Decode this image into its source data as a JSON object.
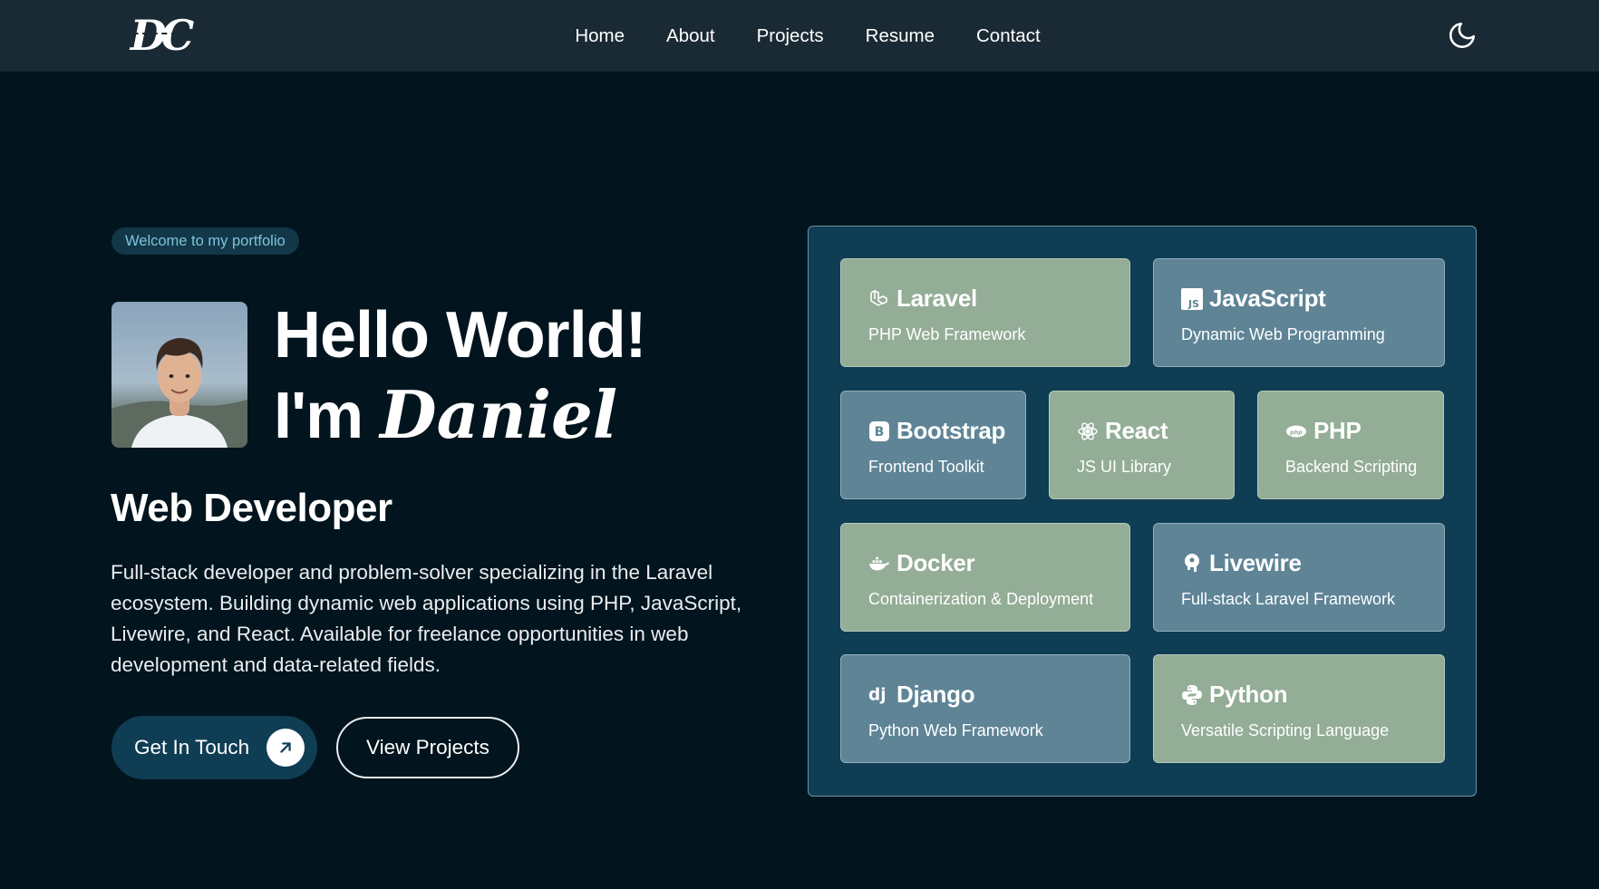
{
  "header": {
    "logo_text": "DC",
    "nav": [
      {
        "label": "Home"
      },
      {
        "label": "About"
      },
      {
        "label": "Projects"
      },
      {
        "label": "Resume"
      },
      {
        "label": "Contact"
      }
    ],
    "theme_icon": "moon-icon"
  },
  "hero": {
    "welcome": "Welcome to my portfolio",
    "greeting_line1": "Hello World!",
    "greeting_prefix": "I'm",
    "name": "Daniel",
    "role": "Web Developer",
    "bio": "Full-stack developer and problem-solver specializing in the Laravel ecosystem. Building dynamic web applications using PHP, JavaScript, Livewire, and React. Available for freelance opportunities in web development and data-related fields.",
    "primary_button": "Get In Touch",
    "primary_button_icon": "arrow-up-right-icon",
    "secondary_button": "View Projects"
  },
  "tech": {
    "cards": [
      {
        "title": "Laravel",
        "subtitle": "PHP Web Framework",
        "icon": "laravel-icon",
        "color": "#93ad96"
      },
      {
        "title": "JavaScript",
        "subtitle": "Dynamic Web Programming",
        "icon": "javascript-icon",
        "color": "#5e8496"
      },
      {
        "title": "Bootstrap",
        "subtitle": "Frontend Toolkit",
        "icon": "bootstrap-icon",
        "color": "#5e8496"
      },
      {
        "title": "React",
        "subtitle": "JS UI Library",
        "icon": "react-icon",
        "color": "#93ad96"
      },
      {
        "title": "PHP",
        "subtitle": "Backend Scripting",
        "icon": "php-icon",
        "color": "#93ad96"
      },
      {
        "title": "Docker",
        "subtitle": "Containerization & Deployment",
        "icon": "docker-icon",
        "color": "#93ad96"
      },
      {
        "title": "Livewire",
        "subtitle": "Full-stack Laravel Framework",
        "icon": "livewire-icon",
        "color": "#5e8496"
      },
      {
        "title": "Django",
        "subtitle": "Python Web Framework",
        "icon": "django-icon",
        "color": "#5e8496"
      },
      {
        "title": "Python",
        "subtitle": "Versatile Scripting Language",
        "icon": "python-icon",
        "color": "#93ad96"
      }
    ]
  },
  "colors": {
    "background": "#02141d",
    "navbar": "#1a2a35",
    "panel": "#0e3d54",
    "card_green": "#93ad96",
    "card_blue": "#5e8496",
    "accent": "#7fc3dc"
  }
}
